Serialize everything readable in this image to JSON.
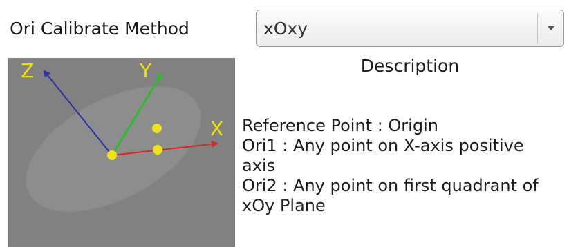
{
  "method": {
    "label": "Ori Calibrate Method",
    "selected": "xOxy"
  },
  "diagram": {
    "axis_labels": {
      "x": "X",
      "y": "Y",
      "z": "Z"
    },
    "colors": {
      "x_axis": "#d42a2a",
      "y_axis": "#2fbb2f",
      "z_axis": "#2b32a8",
      "labels": "#f2e200",
      "points": "#efe21a",
      "background": "#818181",
      "plane": "#8f8f8f"
    }
  },
  "description": {
    "title": "Description",
    "lines": [
      "Reference Point : Origin",
      "Ori1 : Any point on X-axis positive",
      "axis",
      "Ori2 : Any point on first quadrant of",
      "xOy Plane"
    ]
  }
}
